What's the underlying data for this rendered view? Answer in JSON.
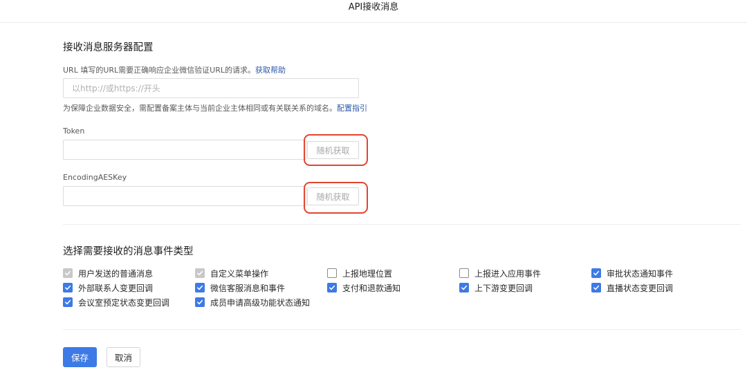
{
  "window": {
    "title": "API接收消息"
  },
  "server_config": {
    "heading": "接收消息服务器配置",
    "url_hint_prefix": "URL  填写的URL需要正确响应企业微信验证URL的请求。",
    "url_help_link": "获取帮助",
    "url_placeholder": "以http://或https://开头",
    "domain_hint": "为保障企业数据安全，需配置备案主体与当前企业主体相同或有关联关系的域名。",
    "domain_guide_link": "配置指引",
    "token_label": "Token",
    "token_value": "",
    "token_random_button": "随机获取",
    "aes_label": "EncodingAESKey",
    "aes_value": "",
    "aes_random_button": "随机获取"
  },
  "events": {
    "heading": "选择需要接收的消息事件类型",
    "items": [
      {
        "label": "用户发送的普通消息",
        "state": "disabled"
      },
      {
        "label": "自定义菜单操作",
        "state": "disabled"
      },
      {
        "label": "上报地理位置",
        "state": "empty"
      },
      {
        "label": "上报进入应用事件",
        "state": "empty"
      },
      {
        "label": "审批状态通知事件",
        "state": "checked"
      },
      {
        "label": "外部联系人变更回调",
        "state": "checked"
      },
      {
        "label": "微信客服消息和事件",
        "state": "checked"
      },
      {
        "label": "支付和退款通知",
        "state": "checked"
      },
      {
        "label": "上下游变更回调",
        "state": "checked"
      },
      {
        "label": "直播状态变更回调",
        "state": "checked"
      },
      {
        "label": "会议室预定状态变更回调",
        "state": "checked"
      },
      {
        "label": "成员申请高级功能状态通知",
        "state": "checked"
      }
    ]
  },
  "actions": {
    "save_label": "保存",
    "cancel_label": "取消"
  },
  "colors": {
    "accent": "#3d7ae6",
    "highlight": "#e0452f",
    "link": "#2f5aa8"
  }
}
